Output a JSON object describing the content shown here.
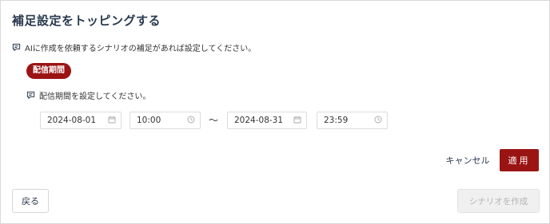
{
  "page": {
    "title": "補足設定をトッピングする",
    "hint": "AIに作成を依頼するシナリオの補足があれば設定してください。"
  },
  "section": {
    "badge": "配信期間",
    "hint": "配信期間を設定してください。"
  },
  "period": {
    "start_date": "2024-08-01",
    "start_time": "10:00",
    "separator": "〜",
    "end_date": "2024-08-31",
    "end_time": "23:59"
  },
  "actions": {
    "cancel_label": "キャンセル",
    "apply_label": "適用",
    "back_label": "戻る",
    "create_label": "シナリオを作成"
  },
  "icons": {
    "hint": "chat-icon",
    "date": "calendar-icon",
    "time": "clock-icon"
  },
  "colors": {
    "accent": "#9b1414",
    "title": "#2a3a4e",
    "disabled_bg": "#f0f0f0",
    "disabled_text": "#b5b5b5"
  }
}
